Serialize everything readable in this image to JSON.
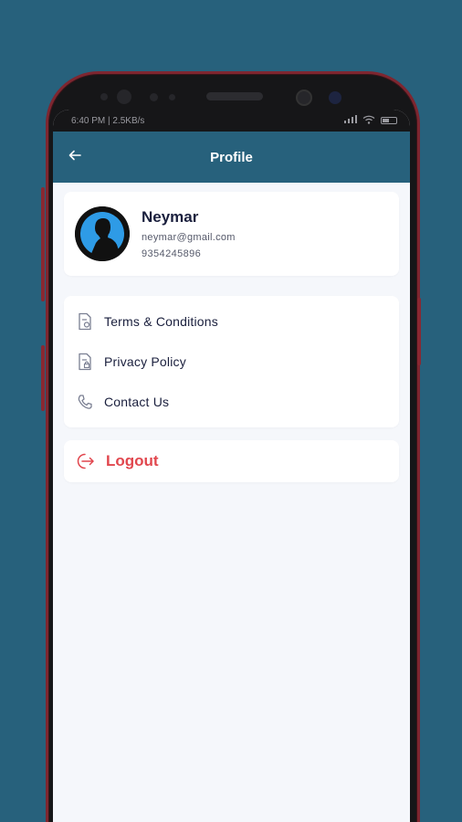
{
  "status_bar": {
    "time_speed": "6:40 PM | 2.5KB/s",
    "battery": ""
  },
  "app_bar": {
    "title": "Profile",
    "back_icon": "arrow-left-icon"
  },
  "profile": {
    "name": "Neymar",
    "email": "neymar@gmail.com",
    "phone": "9354245896",
    "avatar_colors": {
      "background": "#111111",
      "circle": "#2e9be6",
      "silhouette": "#111111"
    }
  },
  "menu": {
    "items": [
      {
        "label": "Terms & Conditions",
        "icon": "document-icon"
      },
      {
        "label": "Privacy Policy",
        "icon": "document-lock-icon"
      },
      {
        "label": "Contact Us",
        "icon": "phone-icon"
      }
    ]
  },
  "logout": {
    "label": "Logout",
    "icon": "logout-icon",
    "color": "#e1474e"
  },
  "colors": {
    "primary": "#27617c",
    "page_bg": "#f5f7fb",
    "text_dark": "#1a1f3d",
    "phone_frame": "#7e2630"
  }
}
